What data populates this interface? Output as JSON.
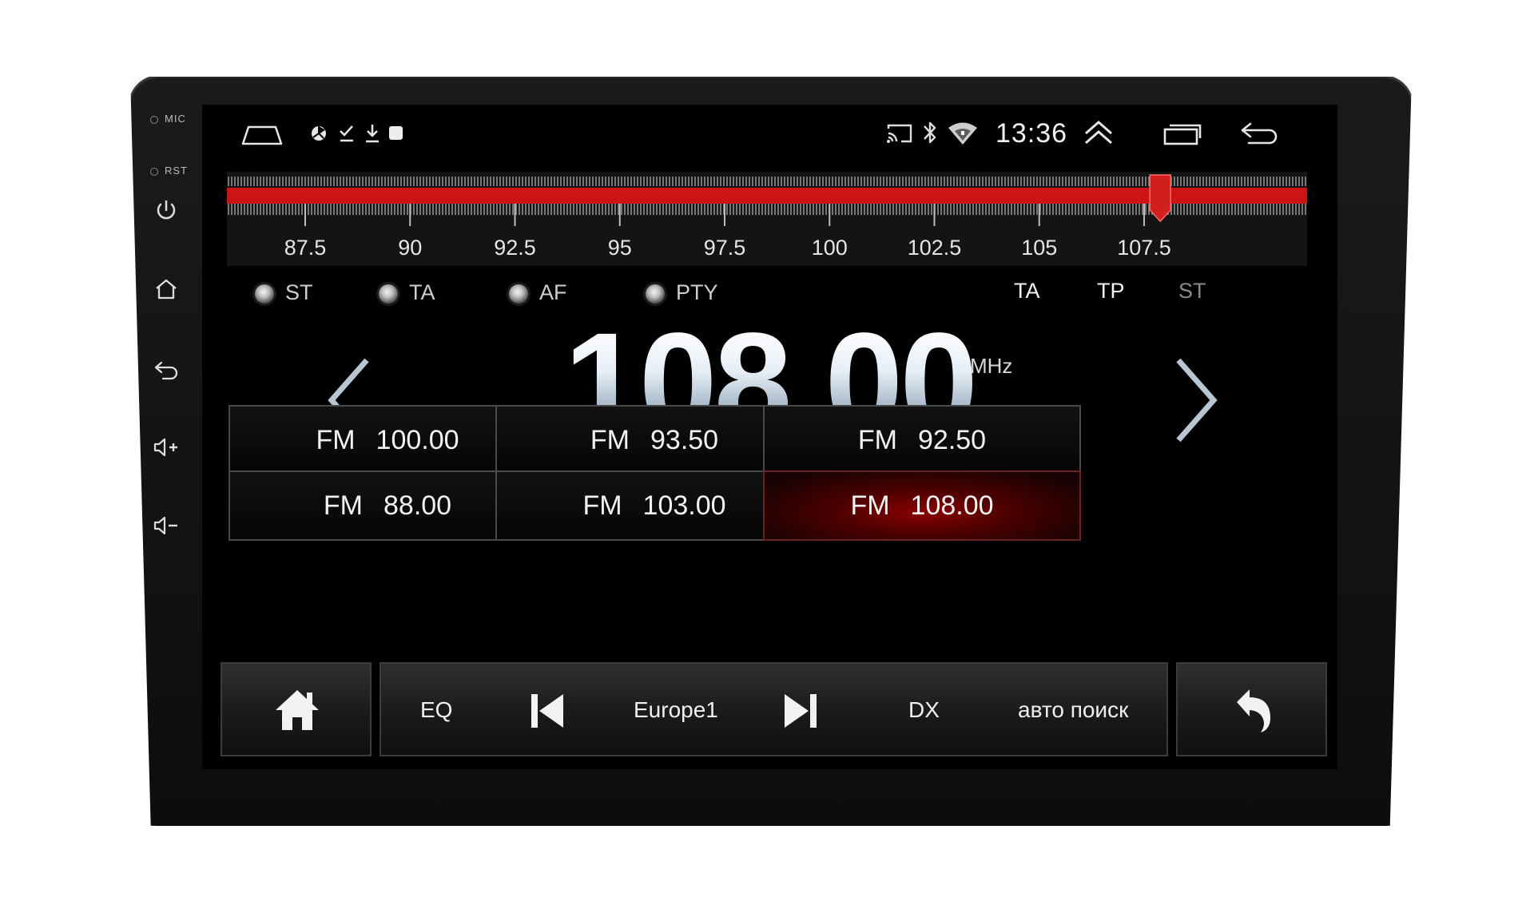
{
  "device": {
    "side_labels": {
      "mic": "MIC",
      "rst": "RST"
    },
    "side_buttons": [
      "power-icon",
      "home-icon",
      "back-icon",
      "volume-up-icon",
      "volume-down-icon"
    ]
  },
  "statusbar": {
    "left_icons": [
      "home-outline-icon",
      "pinwheel-icon",
      "check-download-icon",
      "download-icon",
      "stop-square-icon"
    ],
    "right_icons": [
      "cast-icon",
      "bluetooth-icon",
      "wifi-icon"
    ],
    "time": "13:36",
    "nav_icons": [
      "expand-up-icon",
      "recent-apps-icon",
      "back-arrow-icon"
    ]
  },
  "scale": {
    "ticks": [
      "87.5",
      "90",
      "92.5",
      "95",
      "97.5",
      "100",
      "102.5",
      "105",
      "107.5"
    ],
    "min": 87.5,
    "max": 108.0,
    "pointer_value": 108.0,
    "bar_color": "#cc1414"
  },
  "flags": [
    {
      "label": "ST"
    },
    {
      "label": "TA"
    },
    {
      "label": "AF"
    },
    {
      "label": "PTY"
    }
  ],
  "indicators": [
    {
      "label": "TA",
      "active": true
    },
    {
      "label": "TP",
      "active": true
    },
    {
      "label": "ST",
      "active": false
    }
  ],
  "tuner": {
    "frequency": "108.00",
    "unit": "MHz"
  },
  "presets": [
    {
      "band": "FM",
      "freq": "100.00",
      "active": false
    },
    {
      "band": "FM",
      "freq": "93.50",
      "active": false
    },
    {
      "band": "FM",
      "freq": "92.50",
      "active": false
    },
    {
      "band": "FM",
      "freq": "88.00",
      "active": false
    },
    {
      "band": "FM",
      "freq": "103.00",
      "active": false
    },
    {
      "band": "FM",
      "freq": "108.00",
      "active": true
    }
  ],
  "bottom_bar": {
    "eq": "EQ",
    "station": "Europe1",
    "dx": "DX",
    "auto_search": "авто поиск"
  },
  "colors": {
    "accent_red": "#cc1414",
    "active_preset": "#8a0000"
  }
}
